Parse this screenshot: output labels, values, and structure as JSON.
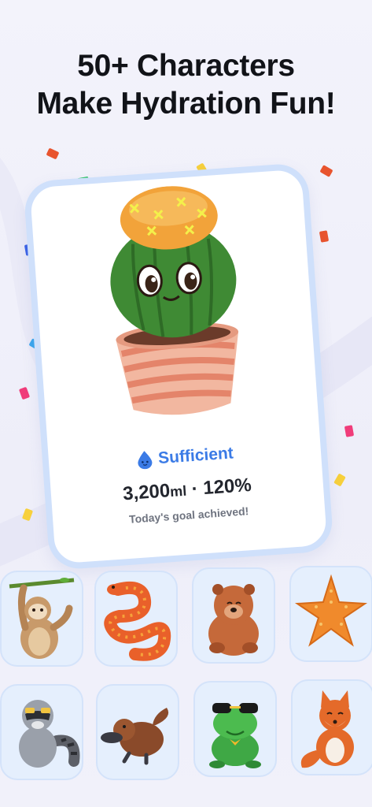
{
  "headline": {
    "line1": "50+ Characters",
    "line2": "Make Hydration Fun!"
  },
  "hero": {
    "character": "cactus",
    "status_icon": "water-drop-icon",
    "status_label": "Sufficient",
    "amount_value": "3,200",
    "amount_unit": "ml",
    "separator": "·",
    "percent": "120%",
    "goal_message": "Today's goal achieved!"
  },
  "characters": [
    {
      "name": "sloth"
    },
    {
      "name": "snake"
    },
    {
      "name": "bear"
    },
    {
      "name": "starfish"
    },
    {
      "name": "raccoon"
    },
    {
      "name": "platypus"
    },
    {
      "name": "frog"
    },
    {
      "name": "fox"
    }
  ],
  "colors": {
    "accent": "#3b7be6",
    "card_border": "#cfe0fb",
    "tile_bg": "#e5effd"
  }
}
